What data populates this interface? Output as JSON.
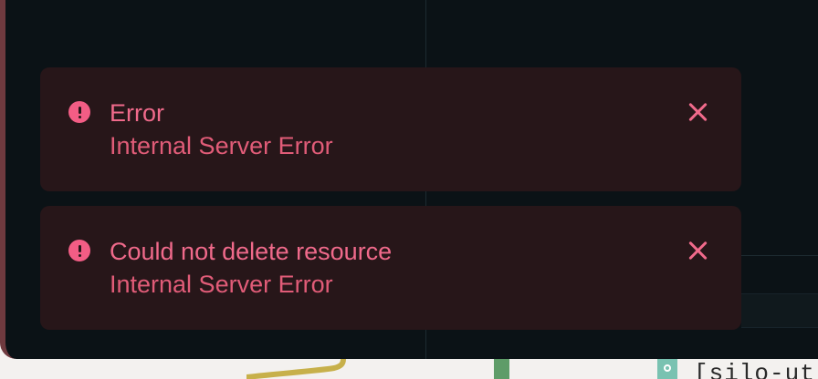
{
  "notifications": [
    {
      "title": "Error",
      "message": "Internal Server Error"
    },
    {
      "title": "Could not delete resource",
      "message": "Internal Server Error"
    }
  ],
  "background": {
    "terminal_fragment": "[silo-ut"
  },
  "colors": {
    "window_bg": "#0b1216",
    "toast_bg": "#271619",
    "error_accent": "#f06a8b",
    "error_text": "#e15c78",
    "yellow_line": "#c7b04a",
    "green_bar": "#5e9c68",
    "teal_chip": "#79c2b1"
  },
  "icons": {
    "error": "exclamation-circle-icon",
    "close": "close-icon"
  }
}
